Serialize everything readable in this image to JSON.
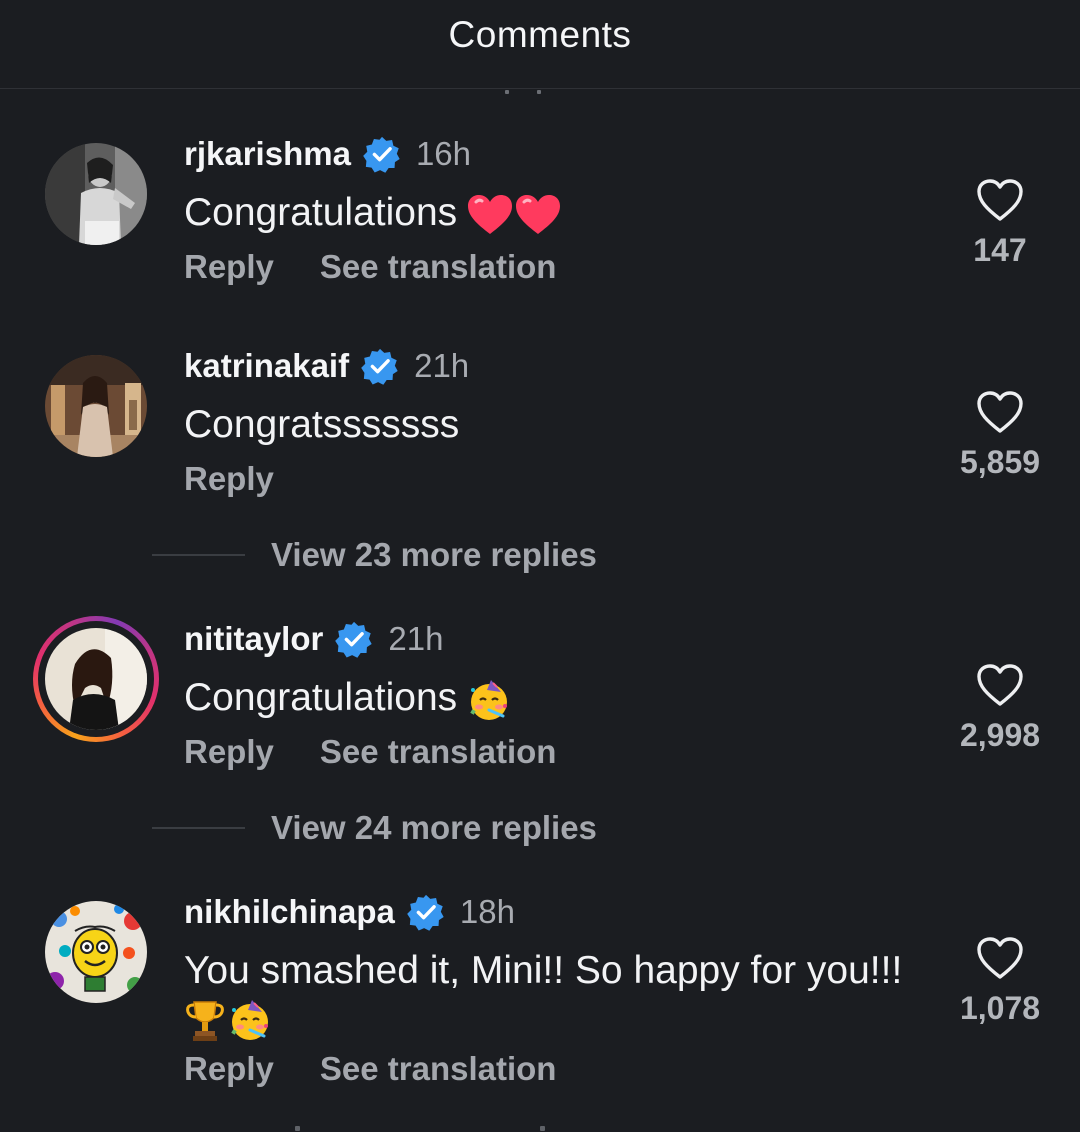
{
  "header": {
    "title": "Comments"
  },
  "comments": [
    {
      "username": "rjkarishma",
      "time": "16h",
      "text": "Congratulations",
      "emoji": [
        "red-heart",
        "red-heart"
      ],
      "reply_label": "Reply",
      "translation_label": "See translation",
      "likes": "147"
    },
    {
      "username": "katrinakaif",
      "time": "21h",
      "text": "Congratsssssss",
      "reply_label": "Reply",
      "likes": "5,859",
      "view_replies": "View 23 more replies"
    },
    {
      "username": "nititaylor",
      "time": "21h",
      "text": "Congratulations",
      "emoji": [
        "partying-face"
      ],
      "reply_label": "Reply",
      "translation_label": "See translation",
      "likes": "2,998",
      "view_replies": "View 24 more replies",
      "has_story_ring": true
    },
    {
      "username": "nikhilchinapa",
      "time": "18h",
      "text": "You smashed it, Mini!! So happy for you!!!",
      "emoji": [
        "trophy",
        "partying-face"
      ],
      "reply_label": "Reply",
      "translation_label": "See translation",
      "likes": "1,078"
    }
  ],
  "colors": {
    "background": "#1b1d21",
    "verified_badge": "#3897f0",
    "secondary_text": "#a4a7ad"
  }
}
